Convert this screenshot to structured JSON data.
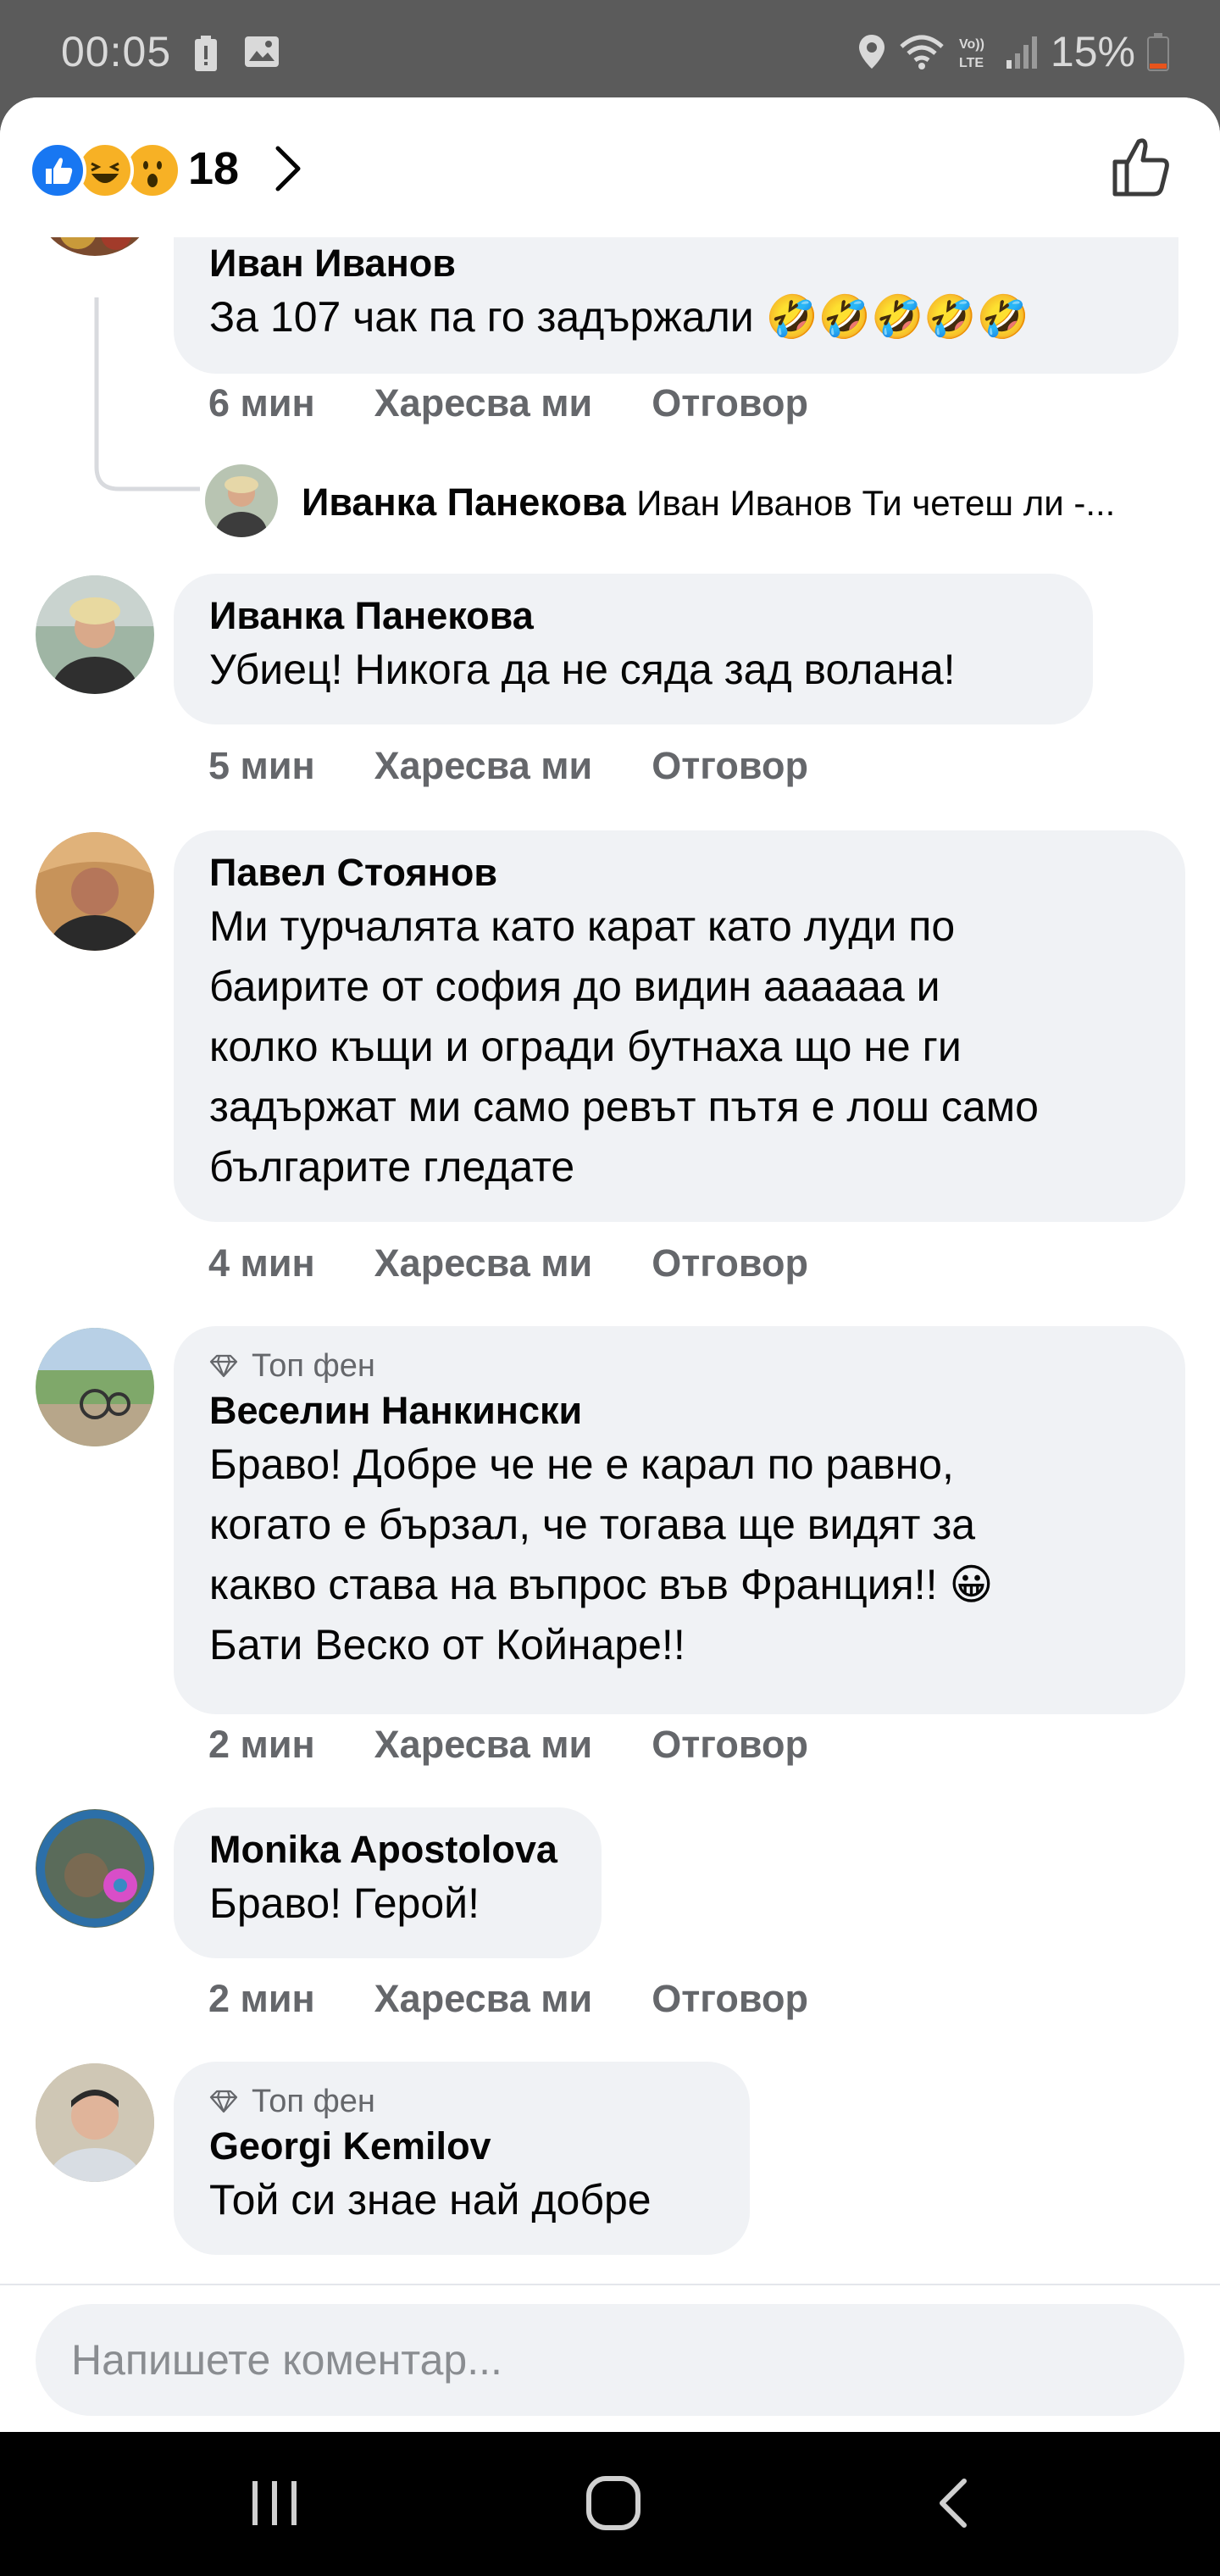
{
  "status_bar": {
    "time": "00:05",
    "battery": "15%"
  },
  "header": {
    "reaction_count": "18",
    "reactions": [
      "like-icon",
      "haha-icon",
      "wow-icon"
    ]
  },
  "comments": [
    {
      "author": "Иван Иванов",
      "text": "За 107 чак па го задържали 🤣🤣🤣🤣🤣",
      "time": "6 мин",
      "like": "Харесва ми",
      "reply": "Отговор",
      "reply_preview": {
        "author": "Иванка Панекова",
        "text": "Иван Иванов Ти четеш ли -..."
      }
    },
    {
      "author": "Иванка Панекова",
      "text": "Убиец! Никога да не сяда зад волана!",
      "time": "5 мин",
      "like": "Харесва ми",
      "reply": "Отговор"
    },
    {
      "author": "Павел Стоянов",
      "lines": [
        "Ми турчалята като карат като луди по",
        "баирите от софия до видин аааааа и",
        "колко къщи и огради бутнаха що не ги",
        "задържат ми само ревът пътя е лош само",
        "българите гледате"
      ],
      "time": "4 мин",
      "like": "Харесва ми",
      "reply": "Отговор"
    },
    {
      "badge": "Топ фен",
      "author": "Веселин Нанкински",
      "lines": [
        "Браво! Добре че не е карал по равно,",
        "когато е бързал, че тогава ще видят за",
        "какво става на въпрос във Франция!! 😀",
        "Бати Веско от Койнаре!!"
      ],
      "time": "2 мин",
      "like": "Харесва ми",
      "reply": "Отговор"
    },
    {
      "author": "Monika Apostolova",
      "text": "Браво! Герой!",
      "time": "2 мин",
      "like": "Харесва ми",
      "reply": "Отговор"
    },
    {
      "badge": "Топ фен",
      "author": "Georgi Kemilov",
      "text": "Той си знае най добре"
    }
  ],
  "input": {
    "placeholder": "Напишете коментар..."
  },
  "colors": {
    "bubble": "#f0f2f5",
    "meta": "#65676b",
    "like_blue": "#1877f2",
    "reaction_yellow": "#f7b125"
  }
}
